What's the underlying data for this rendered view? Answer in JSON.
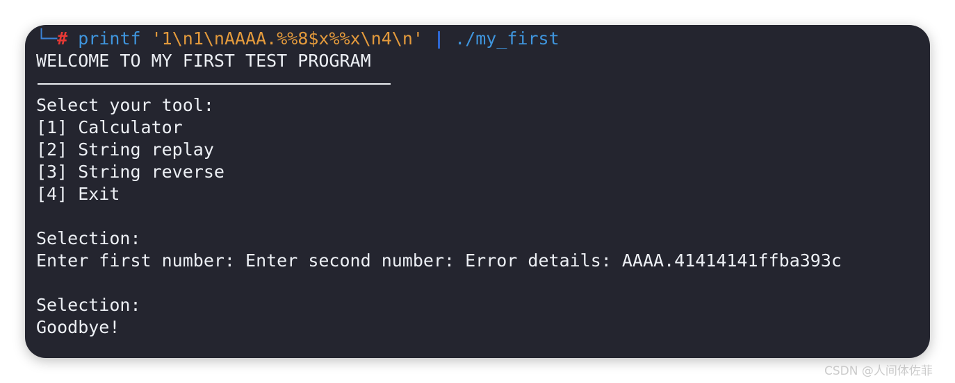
{
  "terminal": {
    "prompt_corner": "└─",
    "prompt_symbol": "#",
    "command": {
      "name": "printf",
      "argument": "'1\\n1\\nAAAA.%%8$x%%x\\n4\\n'",
      "pipe": "|",
      "target": "./my_first"
    },
    "output": [
      "WELCOME TO MY FIRST TEST PROGRAM",
      "",
      "Select your tool:",
      "[1] Calculator",
      "[2] String replay",
      "[3] String reverse",
      "[4] Exit",
      "",
      "Selection:",
      "Enter first number: Enter second number: Error details: AAAA.41414141ffba393c",
      "",
      "Selection:",
      "Goodbye!"
    ]
  },
  "watermark": "CSDN @人间体佐菲",
  "colors": {
    "background": "#24252f",
    "text": "#eceff4",
    "command": "#3f95dd",
    "string": "#e39a3c",
    "prompt": "#e53935"
  }
}
